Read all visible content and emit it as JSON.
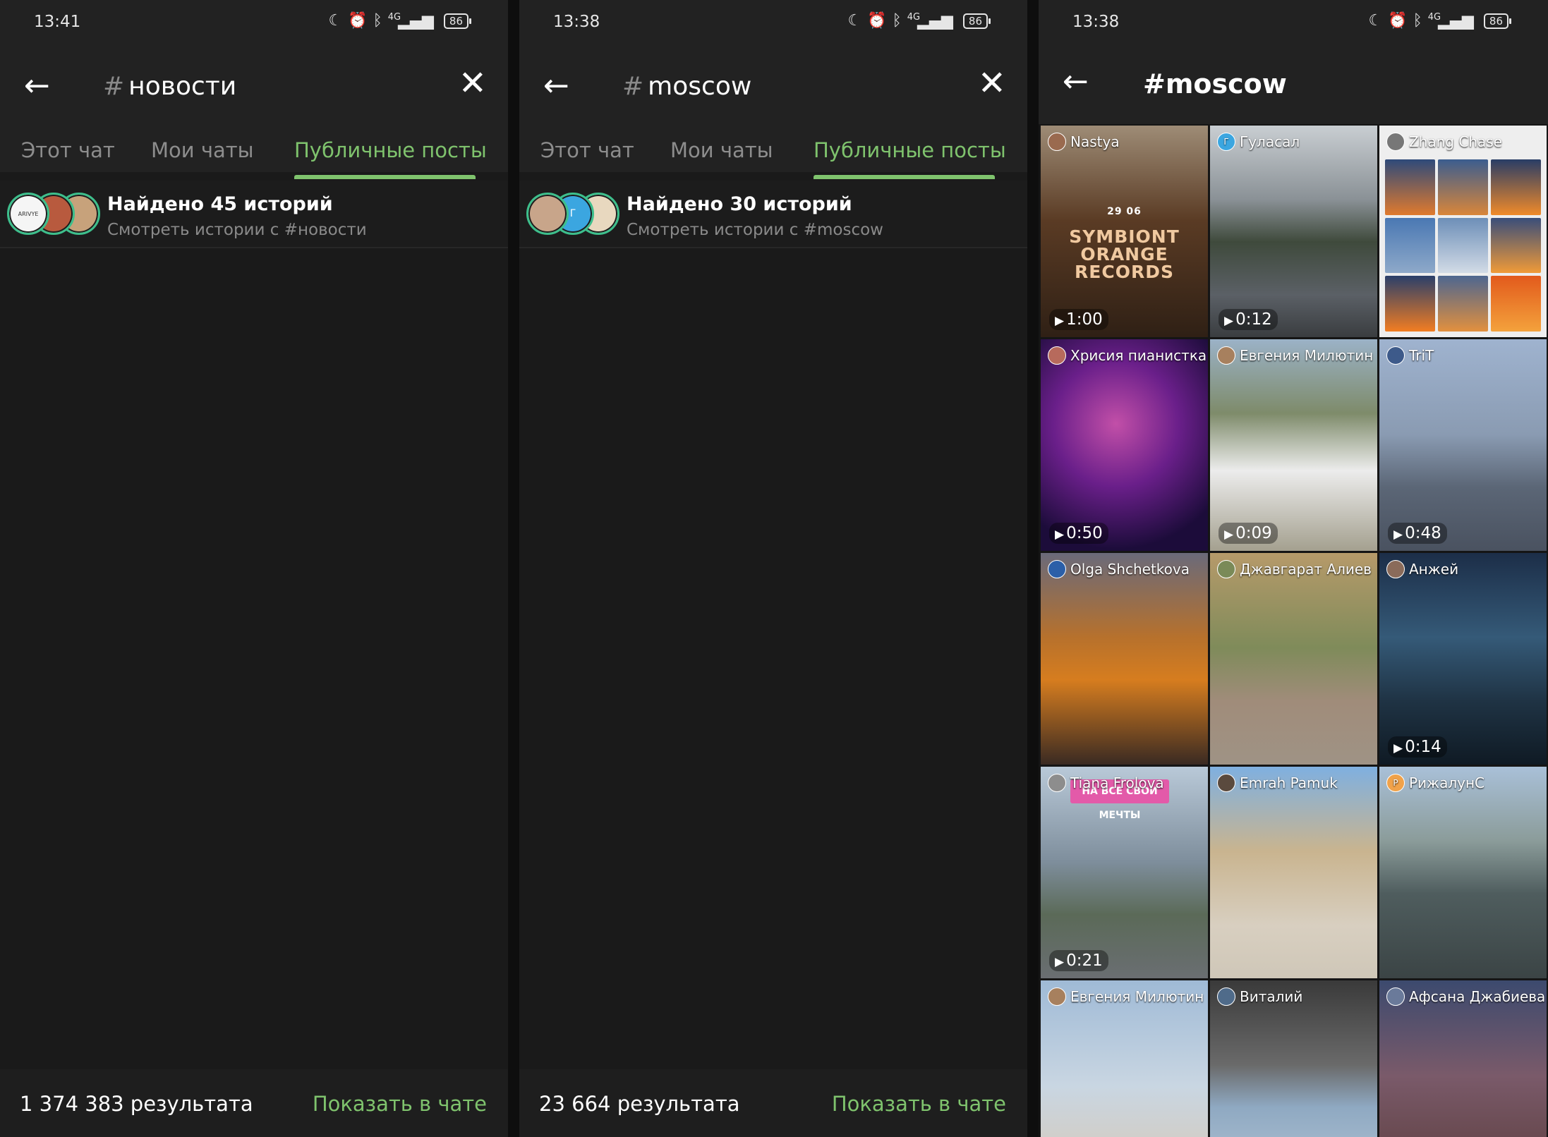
{
  "panel1": {
    "status": {
      "time": "13:41",
      "network": "4G",
      "battery": "86"
    },
    "search": {
      "hash": "#",
      "query": "новости"
    },
    "tabs": [
      {
        "label": "Этот чат"
      },
      {
        "label": "Мои чаты"
      },
      {
        "label": "Публичные посты"
      }
    ],
    "active_tab": "Публичные посты",
    "result": {
      "title": "Найдено 45 историй",
      "subtitle": "Смотреть истории с #новости",
      "avatar_text": "ARIVYE"
    },
    "bottom": {
      "count": "1 374 383 результата",
      "action": "Показать в чате"
    }
  },
  "panel2": {
    "status": {
      "time": "13:38",
      "network": "4G",
      "battery": "86"
    },
    "search": {
      "hash": "#",
      "query": "moscow"
    },
    "tabs": [
      {
        "label": "Этот чат"
      },
      {
        "label": "Мои чаты"
      },
      {
        "label": "Публичные посты"
      }
    ],
    "active_tab": "Публичные посты",
    "result": {
      "title": "Найдено 30 историй",
      "subtitle": "Смотреть истории с #moscow",
      "avatar_text": "Г"
    },
    "bottom": {
      "count": "23 664 результата",
      "action": "Показать в чате"
    }
  },
  "panel3": {
    "status": {
      "time": "13:38",
      "network": "4G",
      "battery": "86"
    },
    "title": "#moscow",
    "stories": [
      {
        "user": "Nastya",
        "duration": "1:00",
        "poster": "SYMBIONT ORANGE RECORDS",
        "poster_date": "29 06"
      },
      {
        "user": "Гуласал",
        "duration": "0:12",
        "avatar_letter": "Г"
      },
      {
        "user": "Zhang Chase",
        "duration": ""
      },
      {
        "user": "Хрисия пианистка",
        "duration": "0:50"
      },
      {
        "user": "Евгения Милютин",
        "duration": "0:09"
      },
      {
        "user": "TriT",
        "duration": "0:48"
      },
      {
        "user": "Olga Shchetkova",
        "duration": ""
      },
      {
        "user": "Джавгарат Алиев",
        "duration": ""
      },
      {
        "user": "Анжей",
        "duration": "0:14"
      },
      {
        "user": "Tiana Frolova",
        "duration": "0:21",
        "banner": "НА ВСЕ СВОИ МЕЧТЫ"
      },
      {
        "user": "Emrah Pamuk",
        "duration": ""
      },
      {
        "user": "РижалунС",
        "duration": "",
        "avatar_letter": "Р"
      },
      {
        "user": "Евгения Милютин",
        "duration": ""
      },
      {
        "user": "Виталий",
        "duration": ""
      },
      {
        "user": "Афсана Джабиева",
        "duration": ""
      }
    ]
  },
  "icons": {
    "back": "arrow-left-icon",
    "close": "close-icon",
    "status": [
      "moon-icon",
      "alarm-icon",
      "bluetooth-icon",
      "signal-icon",
      "battery-icon"
    ],
    "play": "play-icon"
  },
  "colors": {
    "accent": "#7fc36d",
    "ring": "#3dbf8c",
    "background": "#1a1a1a",
    "bar": "#222222"
  }
}
